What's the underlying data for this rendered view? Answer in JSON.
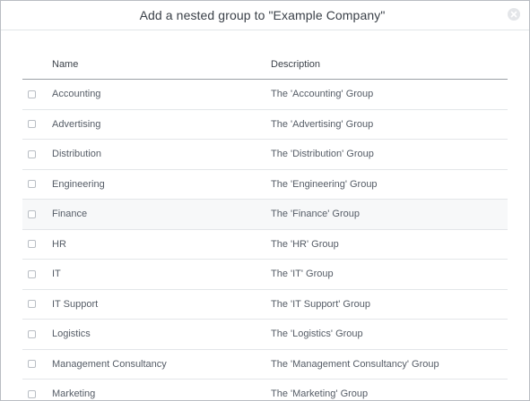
{
  "dialog": {
    "title": "Add a nested group to \"Example Company\""
  },
  "table": {
    "columns": {
      "name": "Name",
      "description": "Description"
    },
    "rows": [
      {
        "name": "Accounting",
        "description": "The 'Accounting' Group"
      },
      {
        "name": "Advertising",
        "description": "The 'Advertising' Group"
      },
      {
        "name": "Distribution",
        "description": "The 'Distribution' Group"
      },
      {
        "name": "Engineering",
        "description": "The 'Engineering' Group"
      },
      {
        "name": "Finance",
        "description": "The 'Finance' Group"
      },
      {
        "name": "HR",
        "description": "The 'HR' Group"
      },
      {
        "name": "IT",
        "description": "The 'IT' Group"
      },
      {
        "name": "IT Support",
        "description": "The 'IT Support' Group"
      },
      {
        "name": "Logistics",
        "description": "The 'Logistics' Group"
      },
      {
        "name": "Management Consultancy",
        "description": "The 'Management Consultancy' Group"
      },
      {
        "name": "Marketing",
        "description": "The 'Marketing' Group"
      }
    ]
  },
  "icons": {
    "close": "close-icon"
  }
}
